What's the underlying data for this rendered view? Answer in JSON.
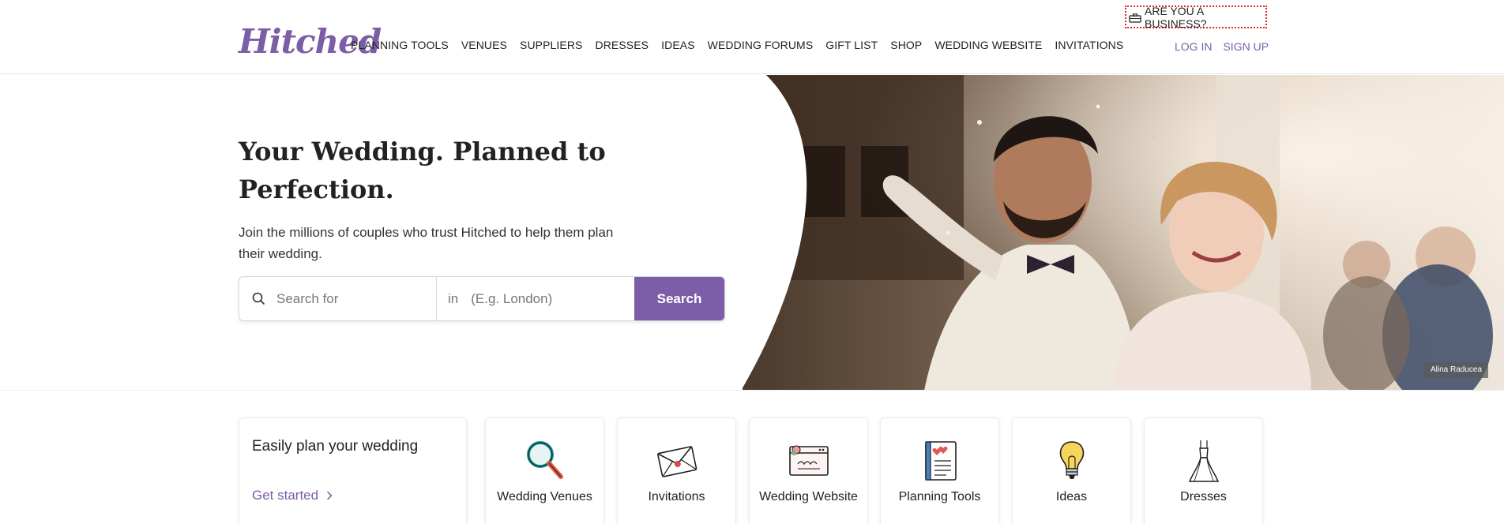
{
  "header": {
    "logo": "Hitched",
    "nav": [
      "PLANNING TOOLS",
      "VENUES",
      "SUPPLIERS",
      "DRESSES",
      "IDEAS",
      "WEDDING FORUMS",
      "GIFT LIST",
      "SHOP",
      "WEDDING WEBSITE",
      "INVITATIONS"
    ],
    "business": "ARE YOU A BUSINESS?",
    "login": "LOG IN",
    "signup": "SIGN UP"
  },
  "hero": {
    "title": "Your Wedding. Planned to Perfection.",
    "subtitle": "Join the millions of couples who trust Hitched to help them plan their wedding.",
    "search_placeholder": "Search for",
    "in_label": "in",
    "location_placeholder": "(E.g. London)",
    "search_button": "Search",
    "photo_credit": "Alina Raducea"
  },
  "plan_card": {
    "title": "Easily plan your wedding",
    "link": "Get started"
  },
  "categories": [
    {
      "label": "Wedding Venues",
      "icon": "magnifier-icon"
    },
    {
      "label": "Invitations",
      "icon": "envelope-icon"
    },
    {
      "label": "Wedding Website",
      "icon": "website-icon"
    },
    {
      "label": "Planning Tools",
      "icon": "notebook-icon"
    },
    {
      "label": "Ideas",
      "icon": "lightbulb-icon"
    },
    {
      "label": "Dresses",
      "icon": "dress-icon"
    }
  ],
  "colors": {
    "brand": "#7b5ea7",
    "business_outline": "#e0262b"
  }
}
